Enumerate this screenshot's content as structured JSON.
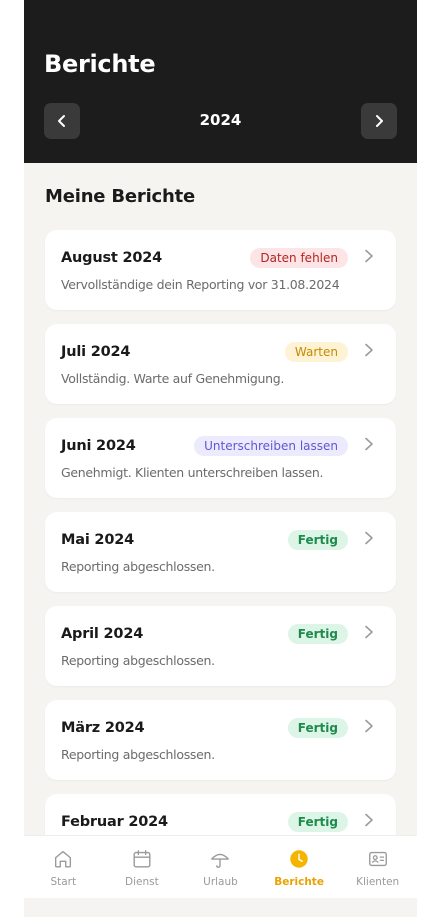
{
  "header": {
    "title": "Berichte",
    "year": "2024"
  },
  "section_title": "Meine Berichte",
  "reports": [
    {
      "month": "August 2024",
      "status": "Daten fehlen",
      "status_color": "red",
      "description": "Vervollständige dein Reporting vor  31.08.2024"
    },
    {
      "month": "Juli 2024",
      "status": "Warten",
      "status_color": "yellow",
      "description": "Vollständig. Warte auf Genehmigung."
    },
    {
      "month": "Juni 2024",
      "status": "Unterschreiben lassen",
      "status_color": "purple",
      "description": "Genehmigt. Klienten unterschreiben lassen."
    },
    {
      "month": "Mai 2024",
      "status": "Fertig",
      "status_color": "green",
      "description": "Reporting abgeschlossen."
    },
    {
      "month": "April 2024",
      "status": "Fertig",
      "status_color": "green",
      "description": "Reporting abgeschlossen."
    },
    {
      "month": "März 2024",
      "status": "Fertig",
      "status_color": "green",
      "description": "Reporting abgeschlossen."
    },
    {
      "month": "Februar 2024",
      "status": "Fertig",
      "status_color": "green",
      "description": ""
    }
  ],
  "tabs": [
    {
      "label": "Start",
      "icon": "home-icon",
      "active": false
    },
    {
      "label": "Dienst",
      "icon": "calendar-icon",
      "active": false
    },
    {
      "label": "Urlaub",
      "icon": "umbrella-icon",
      "active": false
    },
    {
      "label": "Berichte",
      "icon": "clock-icon",
      "active": true
    },
    {
      "label": "Klienten",
      "icon": "id-card-icon",
      "active": false
    }
  ],
  "colors": {
    "header_bg": "#1c1c1c",
    "accent": "#e8a300",
    "background": "#f5f4f0"
  }
}
